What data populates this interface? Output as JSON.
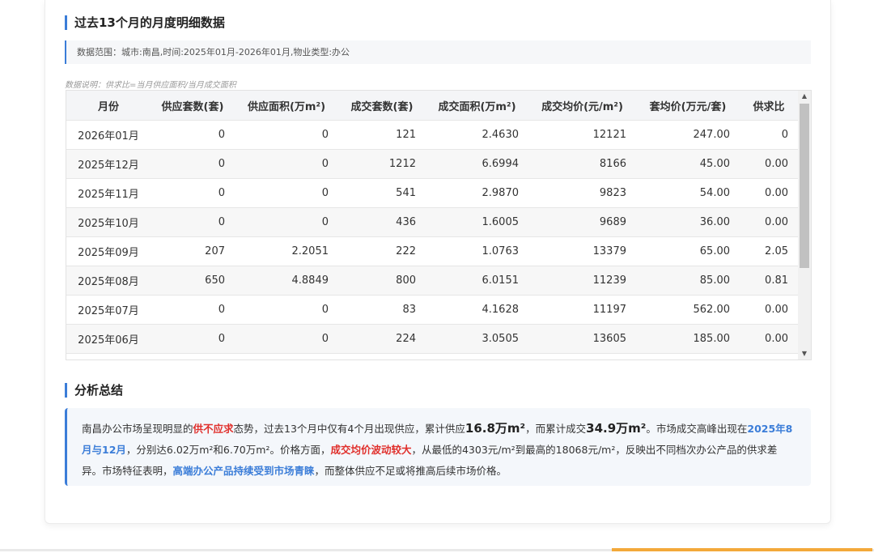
{
  "section1": {
    "title": "过去13个月的月度明细数据"
  },
  "scope": {
    "text": "数据范围：城市:南昌,时间:2025年01月-2026年01月,物业类型:办公"
  },
  "note": {
    "text": "数据说明：供求比=当月供应面积/当月成交面积"
  },
  "table": {
    "headers": [
      "月份",
      "供应套数(套)",
      "供应面积(万m²)",
      "成交套数(套)",
      "成交面积(万m²)",
      "成交均价(元/m²)",
      "套均价(万元/套)",
      "供求比"
    ],
    "rows": [
      [
        "2026年01月",
        "0",
        "0",
        "121",
        "2.4630",
        "12121",
        "247.00",
        "0"
      ],
      [
        "2025年12月",
        "0",
        "0",
        "1212",
        "6.6994",
        "8166",
        "45.00",
        "0.00"
      ],
      [
        "2025年11月",
        "0",
        "0",
        "541",
        "2.9870",
        "9823",
        "54.00",
        "0.00"
      ],
      [
        "2025年10月",
        "0",
        "0",
        "436",
        "1.6005",
        "9689",
        "36.00",
        "0.00"
      ],
      [
        "2025年09月",
        "207",
        "2.2051",
        "222",
        "1.0763",
        "13379",
        "65.00",
        "2.05"
      ],
      [
        "2025年08月",
        "650",
        "4.8849",
        "800",
        "6.0151",
        "11239",
        "85.00",
        "0.81"
      ],
      [
        "2025年07月",
        "0",
        "0",
        "83",
        "4.1628",
        "11197",
        "562.00",
        "0.00"
      ],
      [
        "2025年06月",
        "0",
        "0",
        "224",
        "3.0505",
        "13605",
        "185.00",
        "0.00"
      ]
    ]
  },
  "section2": {
    "title": "分析总结"
  },
  "summary": {
    "p1": "南昌办公市场呈现明显的",
    "h1": "供不应求",
    "p2": "态势，过去13个月中仅有4个月出现供应，累计供应",
    "b1": "16.8万m²",
    "p3": "，而累计成交",
    "b2": "34.9万m²",
    "p4": "。市场成交高峰出现在",
    "h2": "2025年8月与12月",
    "p5": "，分别达6.02万m²和6.70万m²。价格方面，",
    "h3": "成交均价波动较大",
    "p6": "，从最低的4303元/m²到最高的18068元/m²，反映出不同档次办公产品的供求差异。市场特征表明，",
    "h4": "高端办公产品持续受到市场青睐",
    "p7": "，而整体供应不足或将推高后续市场价格。"
  },
  "colors": {
    "accent": "#3b7dd8",
    "highlight_red": "#e0302c",
    "bottom_accent": "#f3a93a"
  },
  "icons": {
    "scroll_up": "triangle-up-icon",
    "scroll_down": "triangle-down-icon"
  }
}
